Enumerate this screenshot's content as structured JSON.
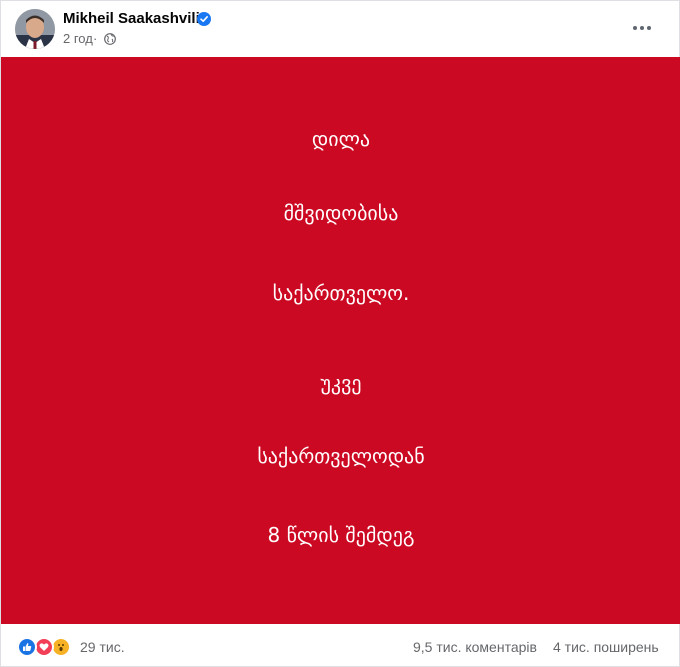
{
  "post": {
    "author": "Mikheil Saakashvili",
    "time": "2 год",
    "separator": "·",
    "image_lines": [
      "დილა",
      "მშვიდობისა",
      "საქართველო.",
      "უკვე",
      "საქართველოდან",
      "8 წლის შემდეგ"
    ]
  },
  "footer": {
    "reactions_count": "29 тис.",
    "comments": "9,5 тис. коментарів",
    "shares": "4 тис. поширень"
  },
  "colors": {
    "image_background": "#cc0922",
    "like_blue": "#1b74e4",
    "love_red": "#f33e58",
    "wow_yellow": "#f7b125",
    "verified_blue": "#1877f2"
  },
  "icons": [
    "avatar",
    "verified-badge-icon",
    "globe-icon",
    "more-options-icon",
    "like-reaction-icon",
    "love-reaction-icon",
    "wow-reaction-icon"
  ]
}
